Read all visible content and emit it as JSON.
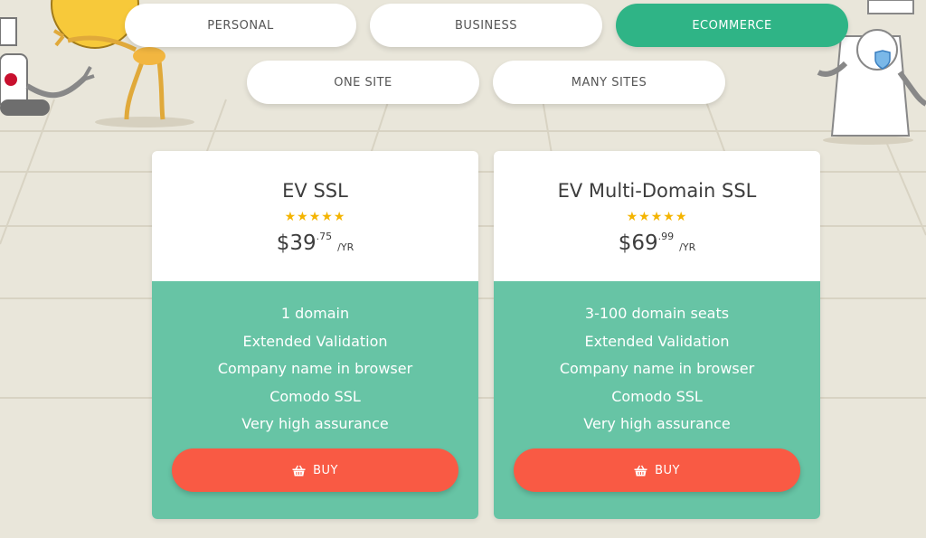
{
  "tabs_row1": [
    {
      "label": "PERSONAL",
      "active": false
    },
    {
      "label": "BUSINESS",
      "active": false
    },
    {
      "label": "ECOMMERCE",
      "active": true
    }
  ],
  "tabs_row2": [
    {
      "label": "ONE SITE",
      "active": false
    },
    {
      "label": "MANY SITES",
      "active": false
    }
  ],
  "cards": [
    {
      "title": "EV SSL",
      "rating": 5,
      "stars": "★★★★★",
      "price_dollars": "$39",
      "price_cents": ".75",
      "price_period": "/YR",
      "features": [
        "1 domain",
        "Extended Validation",
        "Company name in browser",
        "Comodo SSL",
        "Very high assurance"
      ],
      "buy_label": "BUY",
      "buy_icon": "basket-icon"
    },
    {
      "title": "EV Multi-Domain SSL",
      "rating": 5,
      "stars": "★★★★★",
      "price_dollars": "$69",
      "price_cents": ".99",
      "price_period": "/YR",
      "features": [
        "3-100 domain seats",
        "Extended Validation",
        "Company name in browser",
        "Comodo SSL",
        "Very high assurance"
      ],
      "buy_label": "BUY",
      "buy_icon": "basket-icon"
    }
  ],
  "colors": {
    "background": "#e9e6da",
    "active_tab": "#2fb486",
    "feature_panel": "#67c4a5",
    "buy_button": "#f95a44",
    "star": "#f4b400"
  }
}
